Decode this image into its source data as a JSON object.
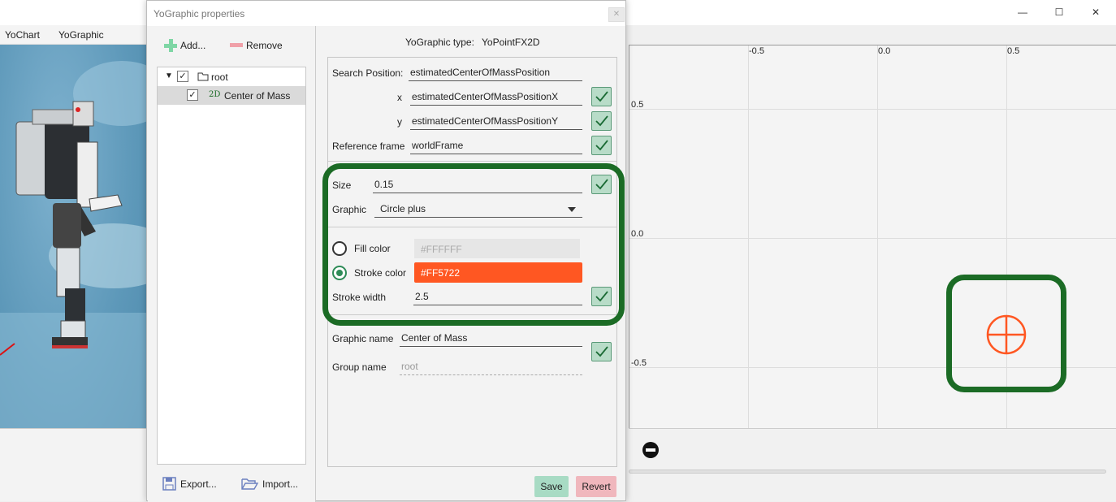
{
  "main_window": {
    "menu": [
      "YoChart",
      "YoGraphic"
    ],
    "controls": {
      "minimize": "—",
      "maximize": "☐",
      "close": "✕"
    }
  },
  "plot": {
    "x_ticks": [
      "-0.5",
      "0.0",
      "0.5"
    ],
    "y_ticks": [
      "0.5",
      "0.0",
      "-0.5"
    ],
    "marker": "circle-plus",
    "marker_color": "#FF5722"
  },
  "dialog": {
    "title": "YoGraphic properties",
    "close_label": "✕",
    "toolbar": {
      "add_label": "Add...",
      "remove_label": "Remove"
    },
    "tree": {
      "root_label": "root",
      "child_badge": "2D",
      "child_label": "Center of Mass"
    },
    "footer": {
      "export_label": "Export...",
      "import_label": "Import..."
    },
    "props": {
      "type_label": "YoGraphic type:",
      "type_value": "YoPointFX2D",
      "search_position_label": "Search Position:",
      "search_position_value": "estimatedCenterOfMassPosition",
      "x_label": "x",
      "x_value": "estimatedCenterOfMassPositionX",
      "y_label": "y",
      "y_value": "estimatedCenterOfMassPositionY",
      "reference_frame_label": "Reference frame",
      "reference_frame_value": "worldFrame",
      "size_label": "Size",
      "size_value": "0.15",
      "graphic_label": "Graphic",
      "graphic_value": "Circle plus",
      "fill_color_label": "Fill color",
      "fill_color_value": "#FFFFFF",
      "stroke_color_label": "Stroke color",
      "stroke_color_value": "#FF5722",
      "stroke_width_label": "Stroke width",
      "stroke_width_value": "2.5",
      "graphic_name_label": "Graphic name",
      "graphic_name_value": "Center of Mass",
      "group_name_label": "Group name",
      "group_name_value": "root"
    },
    "buttons": {
      "save_label": "Save",
      "revert_label": "Revert"
    }
  },
  "colors": {
    "highlight": "#1B6B25",
    "stroke": "#FF5722",
    "accent_green": "#2E8B57"
  }
}
